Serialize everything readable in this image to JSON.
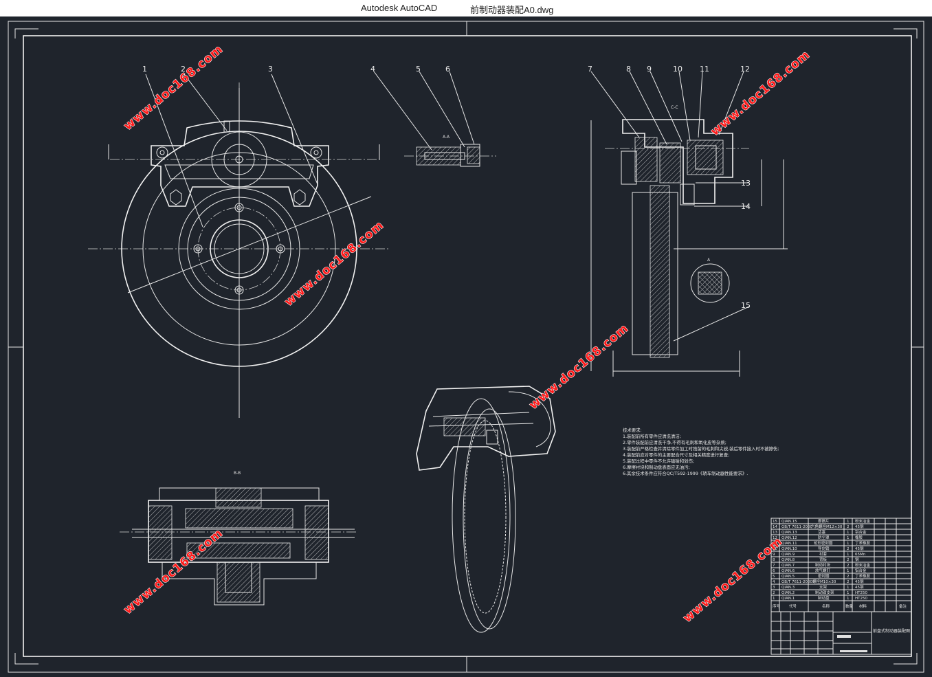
{
  "window": {
    "app_title": "Autodesk AutoCAD",
    "file_name": "前制动器装配A0.dwg"
  },
  "watermark": {
    "text": "www.doc168.com"
  },
  "part_callouts": [
    "1",
    "2",
    "3",
    "4",
    "5",
    "6",
    "7",
    "8",
    "9",
    "10",
    "11",
    "12",
    "13",
    "14",
    "15"
  ],
  "view_labels": {
    "section_aa": "A-A",
    "section_cc": "C-C",
    "section_bb": "B-B",
    "detail_a": "A"
  },
  "technical_requirements": {
    "heading": "技术要求:",
    "items": [
      "1.装配前所有零件应清洗清洁;",
      "2.零件装配前应清洗干净,不得有毛刺和氧化皮等杂质;",
      "3.装配前严格检查并清除零件加工时残留的毛刺和尖锐,装后零件接入时不被擦伤;",
      "4.装配前应对零件的主要配合尺寸及相关精度进行复查;",
      "5.装配过程中零件不允许磕碰和划伤;",
      "6.摩擦衬块和制动盘表面应无油污;",
      "6.其余技术条件应符合QC/T592-1999《轿车制动器性能要求》."
    ]
  },
  "parts_list": {
    "rows": [
      {
        "no": "15",
        "code": "QIAN.15",
        "name": "摩擦片",
        "qty": "1",
        "material": "粉末冶金"
      },
      {
        "no": "14",
        "code": "GB/T 7611-2000",
        "name": "六角螺栓M12×30",
        "qty": "2",
        "material": "45钢"
      },
      {
        "no": "13",
        "code": "QIAN.13",
        "name": "活塞",
        "qty": "1",
        "material": "铝合金"
      },
      {
        "no": "12",
        "code": "QIAN.12",
        "name": "防尘罩",
        "qty": "1",
        "material": "橡胶"
      },
      {
        "no": "11",
        "code": "QIAN.11",
        "name": "矩形密封圈",
        "qty": "1",
        "material": "丁苯橡胶"
      },
      {
        "no": "10",
        "code": "QIAN.10",
        "name": "导向销",
        "qty": "2",
        "material": "45钢"
      },
      {
        "no": "9",
        "code": "QIAN.9",
        "name": "衬套",
        "qty": "1",
        "material": "65Mn"
      },
      {
        "no": "8",
        "code": "QIAN.8",
        "name": "背板",
        "qty": "2",
        "material": "钢"
      },
      {
        "no": "7",
        "code": "QIAN.7",
        "name": "制动衬块",
        "qty": "2",
        "material": "粉末冶金"
      },
      {
        "no": "6",
        "code": "QIAN.6",
        "name": "放气螺钉",
        "qty": "1",
        "material": "铝合金"
      },
      {
        "no": "5",
        "code": "QIAN.5",
        "name": "密封圈",
        "qty": "2",
        "material": "丁苯橡胶"
      },
      {
        "no": "4",
        "code": "GB/T 7611-2000",
        "name": "螺栓M10×30",
        "qty": "2",
        "material": "45钢"
      },
      {
        "no": "3",
        "code": "QIAN.3",
        "name": "支架",
        "qty": "1",
        "material": "45钢"
      },
      {
        "no": "2",
        "code": "QIAN.2",
        "name": "制动钳支架",
        "qty": "1",
        "material": "HT250"
      },
      {
        "no": "1",
        "code": "QIAN.1",
        "name": "制动盘",
        "qty": "1",
        "material": "HT250"
      }
    ],
    "header": {
      "no": "序号",
      "code": "代号",
      "name": "名称",
      "qty": "数量",
      "material": "材料",
      "remark": "备注"
    }
  },
  "title_block": {
    "drawing_title": "前盘式制动器装配图"
  }
}
